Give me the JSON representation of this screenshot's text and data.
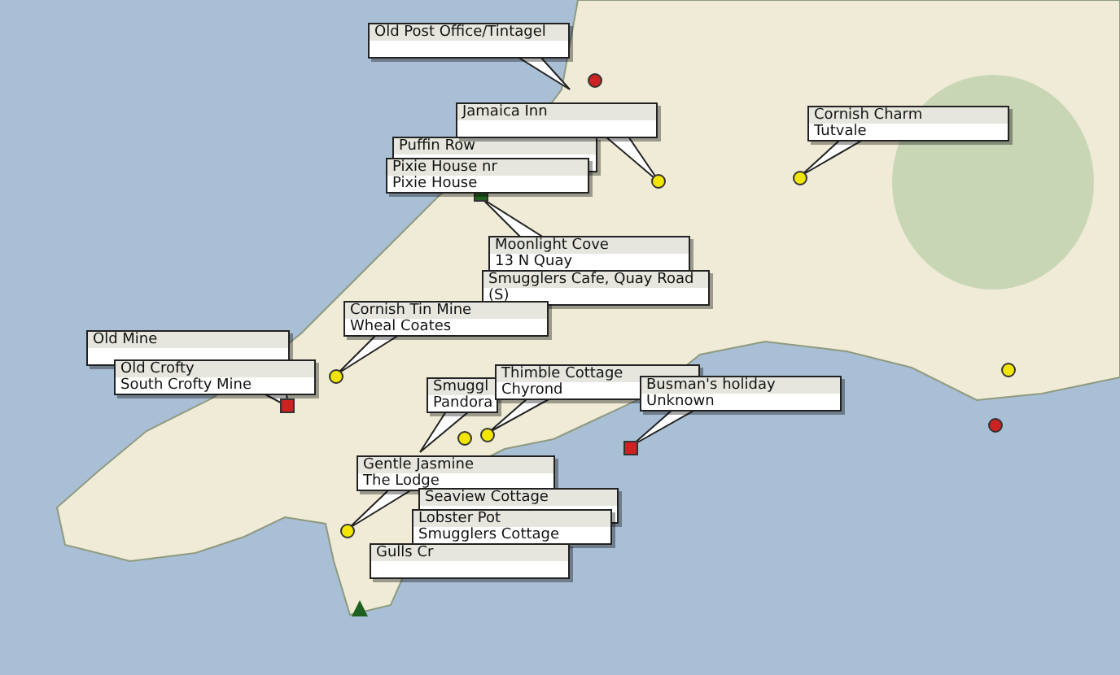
{
  "callouts": [
    {
      "lines": [
        "Old Post Office/Tintagel"
      ]
    },
    {
      "lines": [
        "Puffin Row"
      ]
    },
    {
      "lines": [
        "Pixie House nr",
        "Pixie House"
      ]
    },
    {
      "lines": [
        "Jamaica Inn"
      ]
    },
    {
      "lines": [
        "Cornish Charm",
        "Tutvale"
      ]
    },
    {
      "lines": [
        "Moonlight Cove",
        "13 N Quay"
      ]
    },
    {
      "lines": [
        "Smugglers Cafe, Quay Road",
        "(S)"
      ]
    },
    {
      "lines": [
        "Old Mine"
      ]
    },
    {
      "lines": [
        "Old Crofty",
        "South Crofty Mine"
      ]
    },
    {
      "lines": [
        "Cornish Tin Mine",
        "Wheal Coates"
      ]
    },
    {
      "lines": [
        "Smuggl",
        "Pandora"
      ]
    },
    {
      "lines": [
        "Thimble Cottage",
        "Chyrond"
      ]
    },
    {
      "lines": [
        "Busman's holiday",
        "Unknown"
      ]
    },
    {
      "lines": [
        "Gentle Jasmine",
        "The Lodge"
      ]
    },
    {
      "lines": [
        "Seaview Cottage"
      ]
    },
    {
      "lines": [
        "Lobster Pot",
        "Smugglers Cottage"
      ]
    },
    {
      "lines": [
        "Gulls Cr"
      ]
    }
  ],
  "markers": [
    {
      "kind": "circle",
      "color": "#cc2222"
    },
    {
      "kind": "circle",
      "color": "#f2e600"
    },
    {
      "kind": "circle",
      "color": "#f2e600"
    },
    {
      "kind": "square",
      "color": "#1f5f1f"
    },
    {
      "kind": "circle",
      "color": "#f2e600"
    },
    {
      "kind": "square",
      "color": "#cc2222"
    },
    {
      "kind": "circle",
      "color": "#f2e600"
    },
    {
      "kind": "circle",
      "color": "#f2e600"
    },
    {
      "kind": "square",
      "color": "#cc2222"
    },
    {
      "kind": "circle",
      "color": "#f2e600"
    },
    {
      "kind": "triangle",
      "color": "#1f5f1f"
    },
    {
      "kind": "circle",
      "color": "#f2e600"
    },
    {
      "kind": "circle",
      "color": "#cc2222"
    }
  ]
}
